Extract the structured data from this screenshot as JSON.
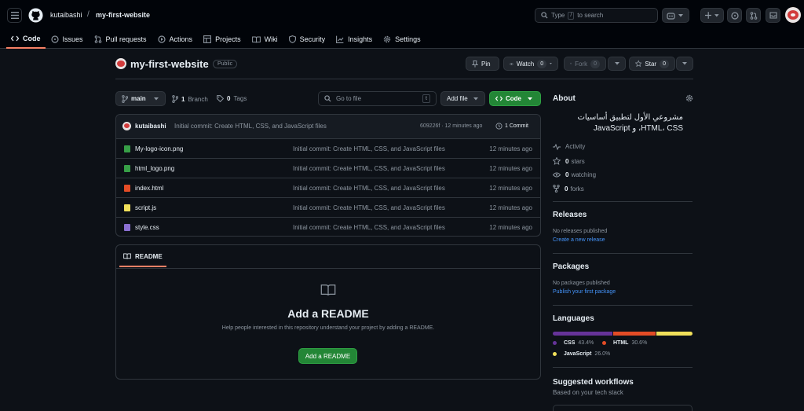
{
  "header": {
    "owner": "kutaibashi",
    "slash": "/",
    "repo": "my-first-website",
    "search_label": "Type",
    "search_key": "/",
    "search_suffix": "to search"
  },
  "tabs": [
    {
      "label": "Code",
      "icon": "code-icon"
    },
    {
      "label": "Issues",
      "icon": "issue-icon"
    },
    {
      "label": "Pull requests",
      "icon": "pull-request-icon"
    },
    {
      "label": "Actions",
      "icon": "play-icon"
    },
    {
      "label": "Projects",
      "icon": "table-icon"
    },
    {
      "label": "Wiki",
      "icon": "book-icon"
    },
    {
      "label": "Security",
      "icon": "shield-icon"
    },
    {
      "label": "Insights",
      "icon": "graph-icon"
    },
    {
      "label": "Settings",
      "icon": "gear-icon"
    }
  ],
  "repo_header": {
    "name": "my-first-website",
    "visibility": "Public",
    "pin": "Pin",
    "watch": "Watch",
    "watch_count": "0",
    "fork": "Fork",
    "fork_count": "0",
    "star": "Star",
    "star_count": "0"
  },
  "toolbar": {
    "branch": "main",
    "branch_count": "1",
    "branch_label": "Branch",
    "tag_count": "0",
    "tag_label": "Tags",
    "goto_placeholder": "Go to file",
    "goto_key": "t",
    "add_file": "Add file",
    "code": "Code"
  },
  "commit": {
    "author": "kutaibashi",
    "message": "Initial commit: Create HTML, CSS, and JavaScript files",
    "hash_time": "609226f · 12 minutes ago",
    "commits": "1 Commit"
  },
  "files": [
    {
      "name": "My-logo-icon.png",
      "message": "Initial commit: Create HTML, CSS, and JavaScript files",
      "date": "12 minutes ago",
      "color": "#3fb950"
    },
    {
      "name": "html_logo.png",
      "message": "Initial commit: Create HTML, CSS, and JavaScript files",
      "date": "12 minutes ago",
      "color": "#3fb950"
    },
    {
      "name": "index.html",
      "message": "Initial commit: Create HTML, CSS, and JavaScript files",
      "date": "12 minutes ago",
      "color": "#e34c26"
    },
    {
      "name": "script.js",
      "message": "Initial commit: Create HTML, CSS, and JavaScript files",
      "date": "12 minutes ago",
      "color": "#f1e05a"
    },
    {
      "name": "style.css",
      "message": "Initial commit: Create HTML, CSS, and JavaScript files",
      "date": "12 minutes ago",
      "color": "#6e5494"
    }
  ],
  "readme": {
    "tab": "README",
    "title": "Add a README",
    "description": "Help people interested in this repository understand your project by adding a README.",
    "button": "Add a README"
  },
  "about": {
    "heading": "About",
    "description": "مشروعي الأول لتطبيق أساسيات HTML، CSS، و JavaScript",
    "activity": "Activity",
    "stars_count": "0",
    "stars": "stars",
    "watching_count": "0",
    "watching": "watching",
    "forks_count": "0",
    "forks": "forks"
  },
  "releases": {
    "heading": "Releases",
    "none": "No releases published",
    "link": "Create a new release"
  },
  "packages": {
    "heading": "Packages",
    "none": "No packages published",
    "link": "Publish your first package"
  },
  "languages": {
    "heading": "Languages",
    "items": [
      {
        "name": "CSS",
        "percent": "43.4%",
        "value": 43.4,
        "color": "#663399"
      },
      {
        "name": "HTML",
        "percent": "30.6%",
        "value": 30.6,
        "color": "#e34c26"
      },
      {
        "name": "JavaScript",
        "percent": "26.0%",
        "value": 26.0,
        "color": "#f1e05a"
      }
    ]
  },
  "workflows": {
    "heading": "Suggested workflows",
    "sub": "Based on your tech stack"
  }
}
